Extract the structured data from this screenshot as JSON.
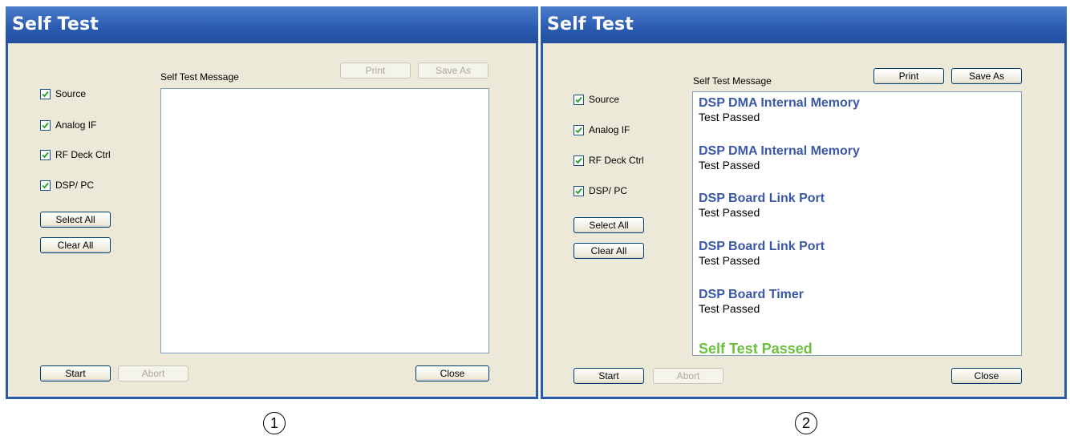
{
  "panel1": {
    "title": "Self Test",
    "message_label": "Self Test Message",
    "print_label": "Print",
    "save_as_label": "Save As",
    "checkboxes": [
      {
        "label": "Source",
        "checked": true
      },
      {
        "label": "Analog IF",
        "checked": true
      },
      {
        "label": "RF Deck Ctrl",
        "checked": true
      },
      {
        "label": "DSP/ PC",
        "checked": true
      }
    ],
    "select_all_label": "Select All",
    "clear_all_label": "Clear All",
    "start_label": "Start",
    "abort_label": "Abort",
    "close_label": "Close",
    "caption": "1"
  },
  "panel2": {
    "title": "Self Test",
    "message_label": "Self Test Message",
    "print_label": "Print",
    "save_as_label": "Save As",
    "checkboxes": [
      {
        "label": "Source",
        "checked": true
      },
      {
        "label": "Analog IF",
        "checked": true
      },
      {
        "label": "RF Deck Ctrl",
        "checked": true
      },
      {
        "label": "DSP/ PC",
        "checked": true
      }
    ],
    "select_all_label": "Select All",
    "clear_all_label": "Clear All",
    "start_label": "Start",
    "abort_label": "Abort",
    "close_label": "Close",
    "messages": [
      {
        "title": "DSP DMA Internal Memory",
        "status": "Test Passed"
      },
      {
        "title": "DSP DMA Internal Memory",
        "status": "Test Passed"
      },
      {
        "title": "DSP Board Link Port",
        "status": "Test Passed"
      },
      {
        "title": "DSP Board Link Port",
        "status": "Test Passed"
      },
      {
        "title": "DSP Board Timer",
        "status": "Test Passed"
      }
    ],
    "final_message": "Self Test Passed",
    "caption": "2"
  },
  "colors": {
    "title_bar": "#2a5bb0",
    "client_bg": "#ece9d8",
    "message_title": "#3a57a8",
    "final_message": "#6cbf3c"
  }
}
